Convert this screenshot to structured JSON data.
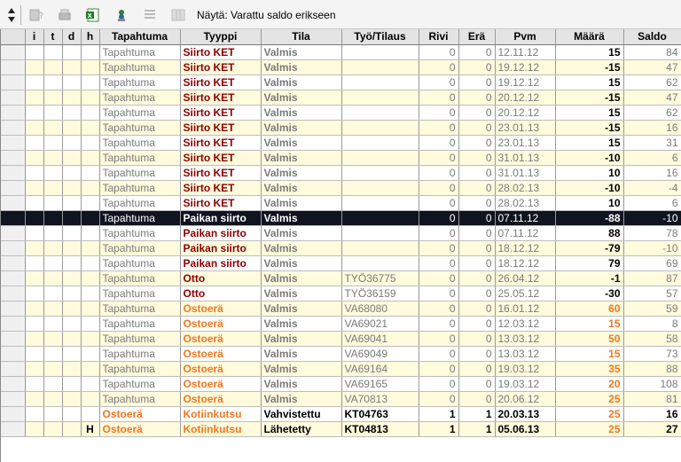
{
  "toolbar": {
    "filter_label": "Näytä: Varattu saldo erikseen",
    "icons": [
      "sort-arrows-icon",
      "filter-clear-icon",
      "print-icon",
      "excel-export-icon",
      "refresh-icon",
      "list-icon",
      "columns-icon"
    ]
  },
  "columns": [
    "",
    "i",
    "t",
    "d",
    "h",
    "Tapahtuma",
    "Tyyppi",
    "Tila",
    "Työ/Tilaus",
    "Rivi",
    "Erä",
    "Pvm",
    "Määrä",
    "Saldo"
  ],
  "rows": [
    {
      "h": "",
      "tapahtuma": "Tapahtuma",
      "tyyppi": "Siirto KET",
      "tila": "Valmis",
      "tyo": "",
      "rivi": "0",
      "era": "0",
      "pvm": "12.11.12",
      "maara": "15",
      "saldo": "84",
      "style": "plain",
      "type_color": "red",
      "gray": true
    },
    {
      "h": "",
      "tapahtuma": "Tapahtuma",
      "tyyppi": "Siirto KET",
      "tila": "Valmis",
      "tyo": "",
      "rivi": "0",
      "era": "0",
      "pvm": "19.12.12",
      "maara": "-15",
      "saldo": "47",
      "style": "alt",
      "type_color": "red",
      "gray": true
    },
    {
      "h": "",
      "tapahtuma": "Tapahtuma",
      "tyyppi": "Siirto KET",
      "tila": "Valmis",
      "tyo": "",
      "rivi": "0",
      "era": "0",
      "pvm": "19.12.12",
      "maara": "15",
      "saldo": "62",
      "style": "plain",
      "type_color": "red",
      "gray": true
    },
    {
      "h": "",
      "tapahtuma": "Tapahtuma",
      "tyyppi": "Siirto KET",
      "tila": "Valmis",
      "tyo": "",
      "rivi": "0",
      "era": "0",
      "pvm": "20.12.12",
      "maara": "-15",
      "saldo": "47",
      "style": "alt",
      "type_color": "red",
      "gray": true
    },
    {
      "h": "",
      "tapahtuma": "Tapahtuma",
      "tyyppi": "Siirto KET",
      "tila": "Valmis",
      "tyo": "",
      "rivi": "0",
      "era": "0",
      "pvm": "20.12.12",
      "maara": "15",
      "saldo": "62",
      "style": "plain",
      "type_color": "red",
      "gray": true
    },
    {
      "h": "",
      "tapahtuma": "Tapahtuma",
      "tyyppi": "Siirto KET",
      "tila": "Valmis",
      "tyo": "",
      "rivi": "0",
      "era": "0",
      "pvm": "23.01.13",
      "maara": "-15",
      "saldo": "16",
      "style": "alt",
      "type_color": "red",
      "gray": true
    },
    {
      "h": "",
      "tapahtuma": "Tapahtuma",
      "tyyppi": "Siirto KET",
      "tila": "Valmis",
      "tyo": "",
      "rivi": "0",
      "era": "0",
      "pvm": "23.01.13",
      "maara": "15",
      "saldo": "31",
      "style": "plain",
      "type_color": "red",
      "gray": true
    },
    {
      "h": "",
      "tapahtuma": "Tapahtuma",
      "tyyppi": "Siirto KET",
      "tila": "Valmis",
      "tyo": "",
      "rivi": "0",
      "era": "0",
      "pvm": "31.01.13",
      "maara": "-10",
      "saldo": "6",
      "style": "alt",
      "type_color": "red",
      "gray": true
    },
    {
      "h": "",
      "tapahtuma": "Tapahtuma",
      "tyyppi": "Siirto KET",
      "tila": "Valmis",
      "tyo": "",
      "rivi": "0",
      "era": "0",
      "pvm": "31.01.13",
      "maara": "10",
      "saldo": "16",
      "style": "plain",
      "type_color": "red",
      "gray": true
    },
    {
      "h": "",
      "tapahtuma": "Tapahtuma",
      "tyyppi": "Siirto KET",
      "tila": "Valmis",
      "tyo": "",
      "rivi": "0",
      "era": "0",
      "pvm": "28.02.13",
      "maara": "-10",
      "saldo": "-4",
      "style": "alt",
      "type_color": "red",
      "gray": true
    },
    {
      "h": "",
      "tapahtuma": "Tapahtuma",
      "tyyppi": "Siirto KET",
      "tila": "Valmis",
      "tyo": "",
      "rivi": "0",
      "era": "0",
      "pvm": "28.02.13",
      "maara": "10",
      "saldo": "6",
      "style": "plain",
      "type_color": "red",
      "gray": true
    },
    {
      "h": "",
      "tapahtuma": "Tapahtuma",
      "tyyppi": "Paikan siirto",
      "tila": "Valmis",
      "tyo": "",
      "rivi": "0",
      "era": "0",
      "pvm": "07.11.12",
      "maara": "-88",
      "saldo": "-10",
      "style": "sel",
      "type_color": "white",
      "gray": true
    },
    {
      "h": "",
      "tapahtuma": "Tapahtuma",
      "tyyppi": "Paikan siirto",
      "tila": "Valmis",
      "tyo": "",
      "rivi": "0",
      "era": "0",
      "pvm": "07.11.12",
      "maara": "88",
      "saldo": "78",
      "style": "plain",
      "type_color": "red",
      "gray": true
    },
    {
      "h": "",
      "tapahtuma": "Tapahtuma",
      "tyyppi": "Paikan siirto",
      "tila": "Valmis",
      "tyo": "",
      "rivi": "0",
      "era": "0",
      "pvm": "18.12.12",
      "maara": "-79",
      "saldo": "-10",
      "style": "alt",
      "type_color": "red",
      "gray": true
    },
    {
      "h": "",
      "tapahtuma": "Tapahtuma",
      "tyyppi": "Paikan siirto",
      "tila": "Valmis",
      "tyo": "",
      "rivi": "0",
      "era": "0",
      "pvm": "18.12.12",
      "maara": "79",
      "saldo": "69",
      "style": "plain",
      "type_color": "red",
      "gray": true
    },
    {
      "h": "",
      "tapahtuma": "Tapahtuma",
      "tyyppi": "Otto",
      "tila": "Valmis",
      "tyo": "TYÖ36775",
      "rivi": "0",
      "era": "0",
      "pvm": "26.04.12",
      "maara": "-1",
      "saldo": "87",
      "style": "alt",
      "type_color": "red",
      "gray": true
    },
    {
      "h": "",
      "tapahtuma": "Tapahtuma",
      "tyyppi": "Otto",
      "tila": "Valmis",
      "tyo": "TYÖ36159",
      "rivi": "0",
      "era": "0",
      "pvm": "25.05.12",
      "maara": "-30",
      "saldo": "57",
      "style": "plain",
      "type_color": "red",
      "gray": true
    },
    {
      "h": "",
      "tapahtuma": "Tapahtuma",
      "tyyppi": "Ostoerä",
      "tila": "Valmis",
      "tyo": "VA68080",
      "rivi": "0",
      "era": "0",
      "pvm": "16.01.12",
      "maara": "60",
      "saldo": "59",
      "style": "alt",
      "type_color": "orange",
      "gray": true,
      "orange_qty": true
    },
    {
      "h": "",
      "tapahtuma": "Tapahtuma",
      "tyyppi": "Ostoerä",
      "tila": "Valmis",
      "tyo": "VA69021",
      "rivi": "0",
      "era": "0",
      "pvm": "12.03.12",
      "maara": "15",
      "saldo": "8",
      "style": "plain",
      "type_color": "orange",
      "gray": true,
      "orange_qty": true
    },
    {
      "h": "",
      "tapahtuma": "Tapahtuma",
      "tyyppi": "Ostoerä",
      "tila": "Valmis",
      "tyo": "VA69041",
      "rivi": "0",
      "era": "0",
      "pvm": "13.03.12",
      "maara": "50",
      "saldo": "58",
      "style": "alt",
      "type_color": "orange",
      "gray": true,
      "orange_qty": true
    },
    {
      "h": "",
      "tapahtuma": "Tapahtuma",
      "tyyppi": "Ostoerä",
      "tila": "Valmis",
      "tyo": "VA69049",
      "rivi": "0",
      "era": "0",
      "pvm": "13.03.12",
      "maara": "15",
      "saldo": "73",
      "style": "plain",
      "type_color": "orange",
      "gray": true,
      "orange_qty": true
    },
    {
      "h": "",
      "tapahtuma": "Tapahtuma",
      "tyyppi": "Ostoerä",
      "tila": "Valmis",
      "tyo": "VA69164",
      "rivi": "0",
      "era": "0",
      "pvm": "19.03.12",
      "maara": "35",
      "saldo": "88",
      "style": "alt",
      "type_color": "orange",
      "gray": true,
      "orange_qty": true
    },
    {
      "h": "",
      "tapahtuma": "Tapahtuma",
      "tyyppi": "Ostoerä",
      "tila": "Valmis",
      "tyo": "VA69165",
      "rivi": "0",
      "era": "0",
      "pvm": "19.03.12",
      "maara": "20",
      "saldo": "108",
      "style": "plain",
      "type_color": "orange",
      "gray": true,
      "orange_qty": true
    },
    {
      "h": "",
      "tapahtuma": "Tapahtuma",
      "tyyppi": "Ostoerä",
      "tila": "Valmis",
      "tyo": "VA70813",
      "rivi": "0",
      "era": "0",
      "pvm": "20.06.12",
      "maara": "25",
      "saldo": "81",
      "style": "alt",
      "type_color": "orange",
      "gray": true,
      "orange_qty": true
    },
    {
      "h": "",
      "tapahtuma": "Ostoerä",
      "tyyppi": "Kotiinkutsu",
      "tila": "Vahvistettu",
      "tyo": "KT04763",
      "rivi": "1",
      "era": "1",
      "pvm": "20.03.13",
      "maara": "25",
      "saldo": "16",
      "style": "plain",
      "type_color": "orange",
      "gray": false,
      "orange_qty": true,
      "tap_orange": true
    },
    {
      "h": "H",
      "tapahtuma": "Ostoerä",
      "tyyppi": "Kotiinkutsu",
      "tila": "Lähetetty",
      "tyo": "KT04813",
      "rivi": "1",
      "era": "1",
      "pvm": "05.06.13",
      "maara": "25",
      "saldo": "27",
      "style": "alt",
      "type_color": "orange",
      "gray": false,
      "orange_qty": true,
      "tap_orange": true
    }
  ]
}
